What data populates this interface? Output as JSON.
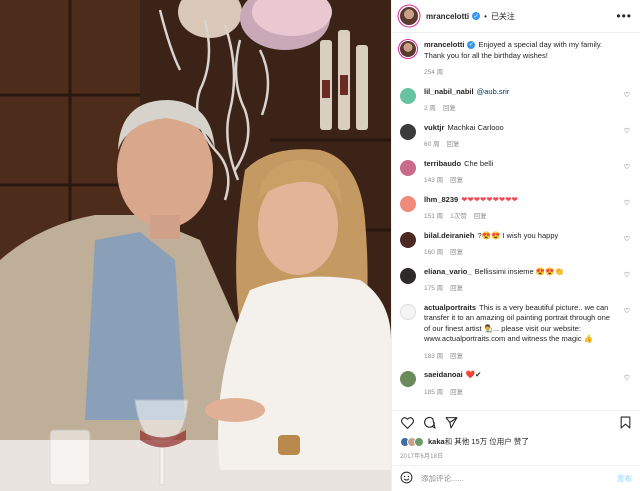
{
  "post": {
    "author": "mrancelotti",
    "verified": true,
    "follow_status": "已关注",
    "caption": "Enjoyed a special day with my family. Thank you for all the birthday wishes!",
    "caption_age": "254 周"
  },
  "comments": [
    {
      "user": "lil_nabil_nabil",
      "text": "@aub.srir",
      "is_mention": true,
      "age": "2 周",
      "likes": "",
      "reply": "回复"
    },
    {
      "user": "vuktjr",
      "text": "Machkai Carlooo",
      "age": "60 周",
      "likes": "",
      "reply": "回复"
    },
    {
      "user": "terribaudo",
      "text": "Che belli",
      "age": "143 周",
      "likes": "",
      "reply": "回复"
    },
    {
      "user": "lhm_8239",
      "text": "❤❤❤❤❤❤❤❤❤",
      "age": "151 周",
      "likes": "1次赞",
      "reply": "回复"
    },
    {
      "user": "bilal.deiranieh",
      "text": "?😍😍 I wish you happy",
      "age": "160 周",
      "likes": "",
      "reply": "回复"
    },
    {
      "user": "eliana_vario_",
      "text": "Bellissimi insieme 😍😍👏",
      "age": "175 周",
      "likes": "",
      "reply": "回复"
    },
    {
      "user": "actualportraits",
      "text": "This is a very beautiful picture.. we can transfer it to an amazing oil painting portrait through one of our finest artist 👨‍🎨... please visit our website: www.actualportraits.com and witness the magic 👍",
      "age": "183 周",
      "likes": "",
      "reply": "回复"
    },
    {
      "user": "saeidanoai",
      "text": "❤️✔",
      "age": "185 周",
      "likes": "",
      "reply": "回复"
    }
  ],
  "likes_line": {
    "first_user": "kaka",
    "text": " 和 其他 15万 位用户 赞了"
  },
  "date": "2017年6月18日",
  "compose": {
    "placeholder": "添加评论......",
    "post_label": "发布"
  },
  "colors": {
    "verified_blue": "#3897f0",
    "link_blue": "#00376b",
    "meta_gray": "#8e8e8e",
    "post_disabled": "#b2dffc",
    "heart_red": "#ed4956"
  }
}
